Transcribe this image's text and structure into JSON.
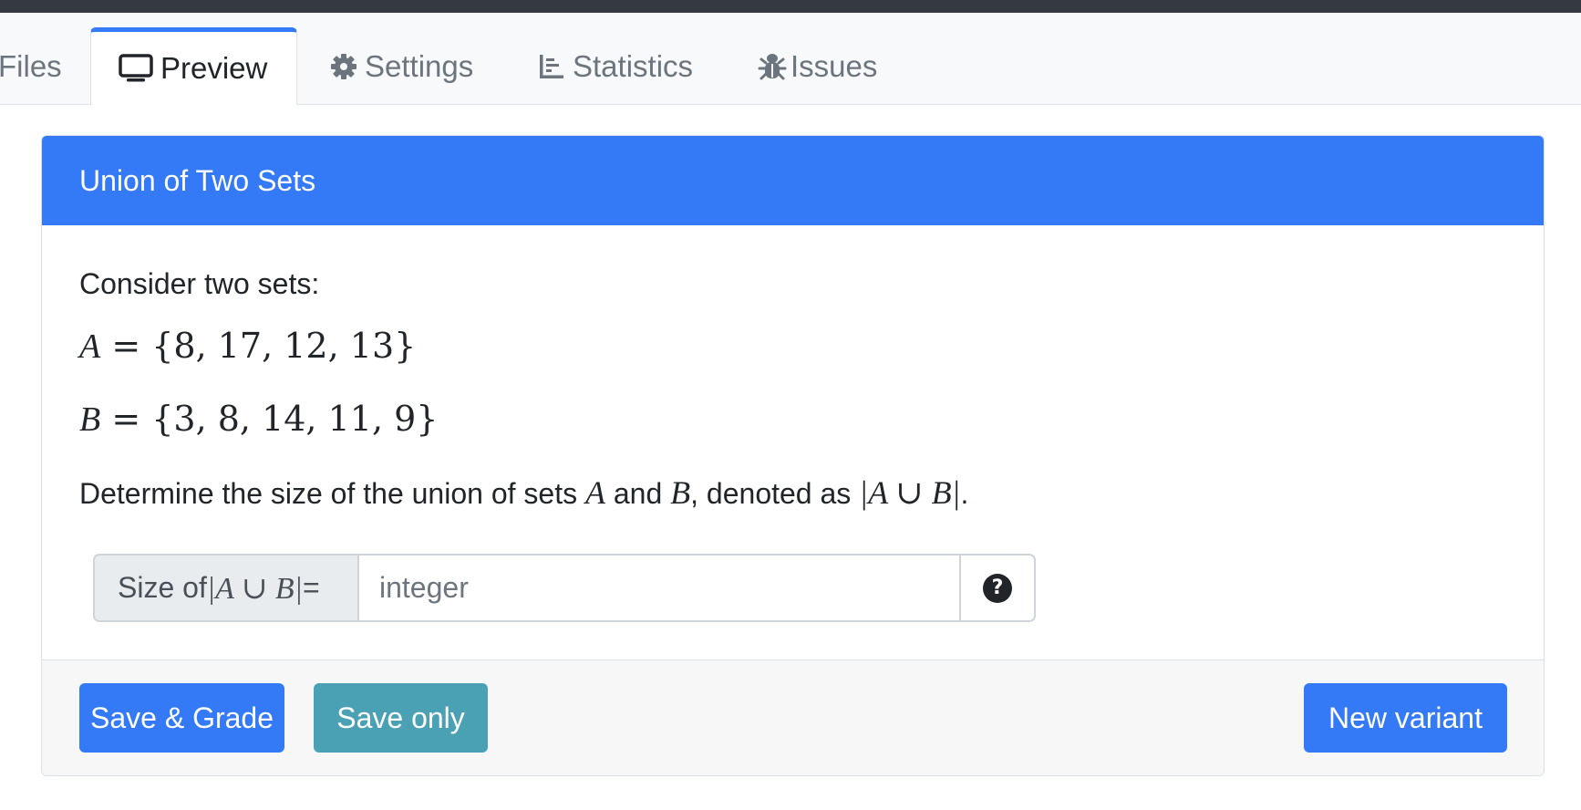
{
  "tabs": [
    {
      "label": "Files",
      "icon": "files-icon",
      "active": false
    },
    {
      "label": "Preview",
      "icon": "monitor-icon",
      "active": true
    },
    {
      "label": "Settings",
      "icon": "gear-icon",
      "active": false
    },
    {
      "label": "Statistics",
      "icon": "chart-icon",
      "active": false
    },
    {
      "label": "Issues",
      "icon": "bug-icon",
      "active": false
    }
  ],
  "question": {
    "title": "Union of Two Sets",
    "intro": "Consider two sets:",
    "set_a_name": "A",
    "set_a_values": "{8, 17, 12, 13}",
    "set_b_name": "B",
    "set_b_values": "{3, 8, 14, 11, 9}",
    "prompt_part1": "Determine the size of the union of sets ",
    "prompt_part2": " and ",
    "prompt_part3": ", denoted as ",
    "prompt_part4": ".",
    "union_expr": "|A ∪ B|"
  },
  "answer": {
    "prepend_label": "Size of",
    "union_expr": "|A ∪ B|",
    "equals": "=",
    "placeholder": "integer",
    "help_symbol": "?"
  },
  "footer": {
    "save_grade_label": "Save & Grade",
    "save_only_label": "Save only",
    "new_variant_label": "New variant"
  },
  "colors": {
    "accent": "#3479f5",
    "save_only": "#4aa1b4",
    "topbar": "#343a40"
  }
}
